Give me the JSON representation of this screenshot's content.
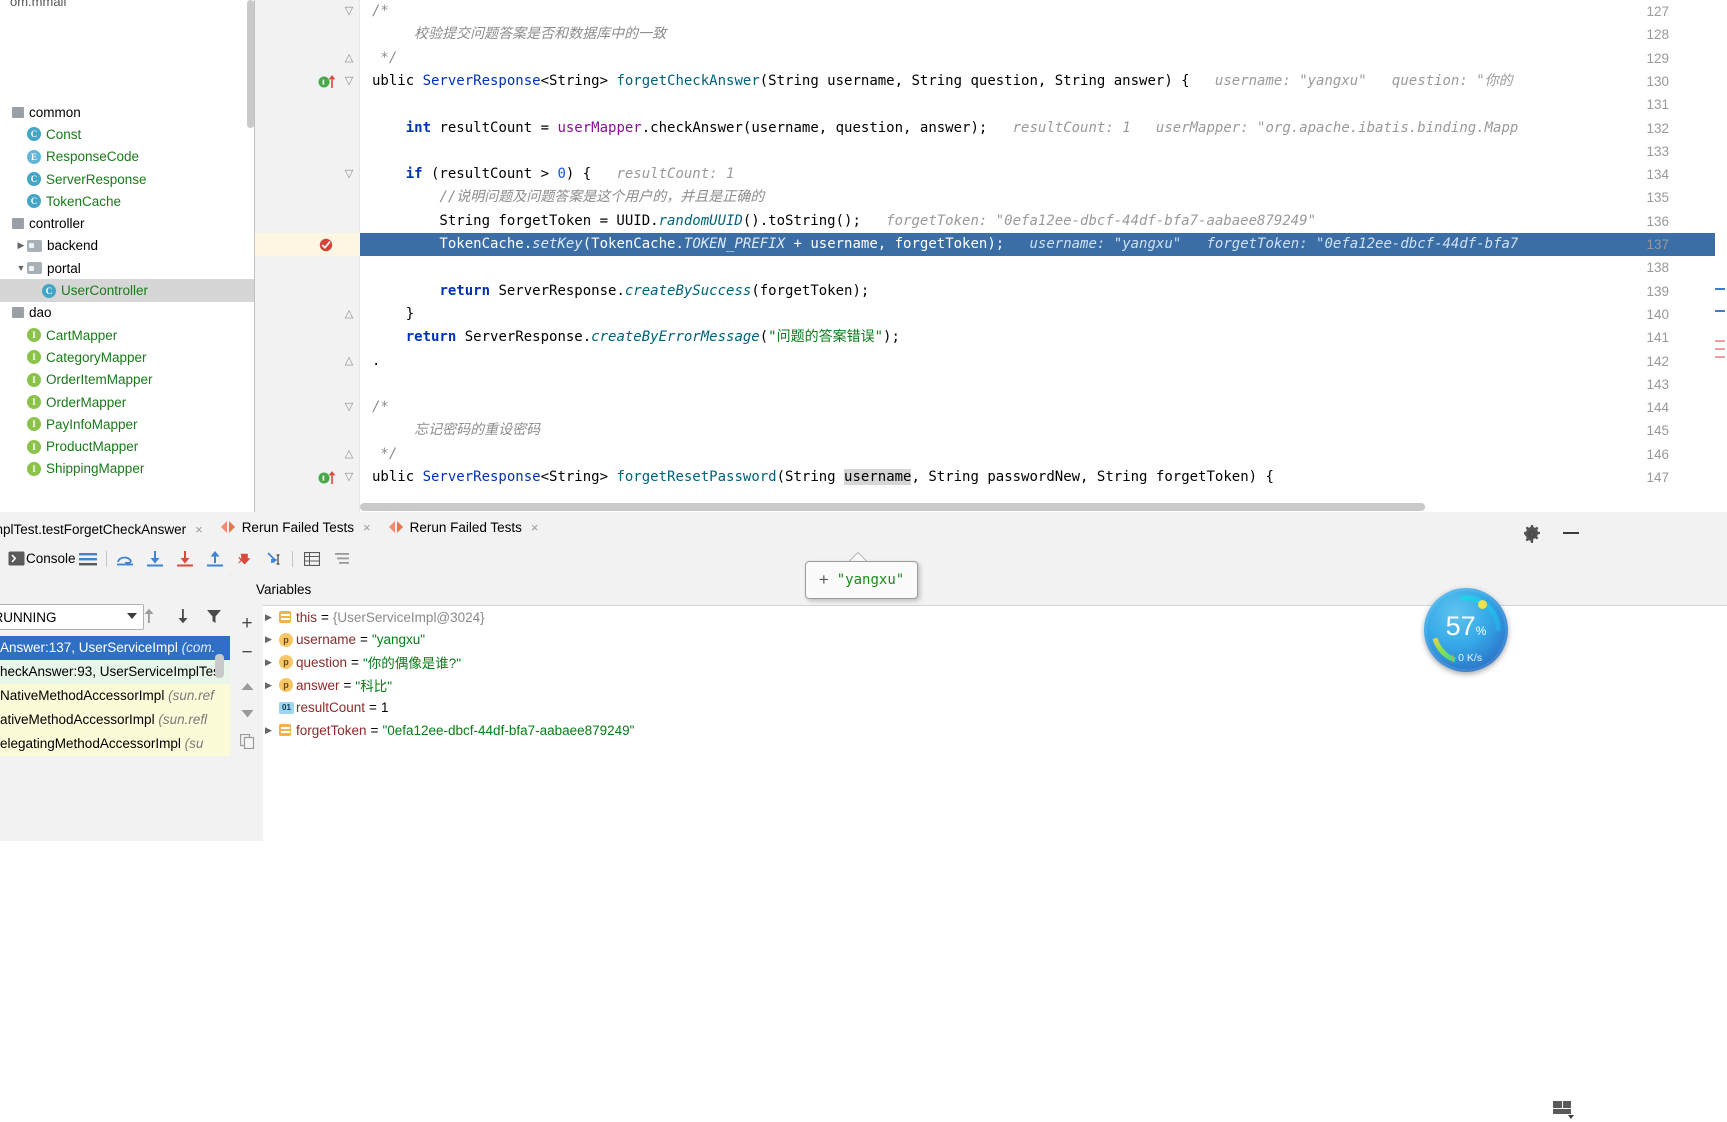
{
  "project": {
    "root": "om.mmall",
    "items": [
      {
        "indent": 0,
        "icon": "package-icon",
        "label": "common",
        "style": "plain",
        "arrow": ""
      },
      {
        "indent": 1,
        "icon": "class-icon",
        "label": "Const",
        "style": "green",
        "arrow": ""
      },
      {
        "indent": 1,
        "icon": "enum-icon",
        "label": "ResponseCode",
        "style": "green",
        "arrow": ""
      },
      {
        "indent": 1,
        "icon": "class-icon",
        "label": "ServerResponse",
        "style": "green",
        "arrow": ""
      },
      {
        "indent": 1,
        "icon": "class-icon",
        "label": "TokenCache",
        "style": "green",
        "arrow": ""
      },
      {
        "indent": 0,
        "icon": "package-icon",
        "label": "controller",
        "style": "plain",
        "arrow": ""
      },
      {
        "indent": 1,
        "icon": "folder-icon",
        "label": "backend",
        "style": "plain",
        "arrow": "▶"
      },
      {
        "indent": 1,
        "icon": "folder-icon",
        "label": "portal",
        "style": "plain",
        "arrow": "▼"
      },
      {
        "indent": 2,
        "icon": "class-icon",
        "label": "UserController",
        "style": "green",
        "arrow": "",
        "selected": true
      },
      {
        "indent": 0,
        "icon": "package-icon",
        "label": "dao",
        "style": "plain",
        "arrow": ""
      },
      {
        "indent": 1,
        "icon": "interface-icon",
        "label": "CartMapper",
        "style": "green",
        "arrow": ""
      },
      {
        "indent": 1,
        "icon": "interface-icon",
        "label": "CategoryMapper",
        "style": "green",
        "arrow": ""
      },
      {
        "indent": 1,
        "icon": "interface-icon",
        "label": "OrderItemMapper",
        "style": "green",
        "arrow": ""
      },
      {
        "indent": 1,
        "icon": "interface-icon",
        "label": "OrderMapper",
        "style": "green",
        "arrow": ""
      },
      {
        "indent": 1,
        "icon": "interface-icon",
        "label": "PayInfoMapper",
        "style": "green",
        "arrow": ""
      },
      {
        "indent": 1,
        "icon": "interface-icon",
        "label": "ProductMapper",
        "style": "green",
        "arrow": ""
      },
      {
        "indent": 1,
        "icon": "interface-icon",
        "label": "ShippingMapper",
        "style": "green",
        "arrow": ""
      }
    ]
  },
  "editor": {
    "first_line": 127,
    "highlight_line": 137,
    "lines": [
      {
        "n": 127,
        "fold": "▽",
        "html": "<span class='cmt'>/*</span>"
      },
      {
        "n": 128,
        "fold": "",
        "html": "<span class='cmt'>     校验提交问题答案是否和数据库中的一致</span>"
      },
      {
        "n": 129,
        "fold": "△",
        "html": "<span class='cmt'> */</span>"
      },
      {
        "n": 130,
        "fold": "▽",
        "gmark": "run-breakpoint",
        "html": "ublic <span class='kw2'>ServerResponse</span>&lt;String&gt; <span class='fn'>forgetCheckAnswer</span>(String username, String question, String answer) {   <span class='hint'>username: \"yangxu\"   question: \"你的</span>"
      },
      {
        "n": 131,
        "fold": "",
        "html": ""
      },
      {
        "n": 132,
        "fold": "",
        "html": "    <span class='kw'>int</span> resultCount = <span class='fld2'>userMapper</span>.checkAnswer(username, question, answer);   <span class='hint'>resultCount: 1   userMapper: \"org.apache.ibatis.binding.Mapp</span>"
      },
      {
        "n": 133,
        "fold": "",
        "html": ""
      },
      {
        "n": 134,
        "fold": "▽",
        "html": "    <span class='kw'>if</span> (resultCount &gt; <span class='num'>0</span>) {   <span class='hint'>resultCount: 1</span>"
      },
      {
        "n": 135,
        "fold": "",
        "html": "        <span class='cmt'>//说明问题及问题答案是这个用户的，并且是正确的</span>"
      },
      {
        "n": 136,
        "fold": "",
        "html": "        String forgetToken = UUID.<span class='stat'>randomUUID</span>().toString();   <span class='hint'>forgetToken: \"0efa12ee-dbcf-44df-bfa7-aabaee879249\"</span>"
      },
      {
        "n": 137,
        "fold": "",
        "gmark": "breakpoint-hit",
        "selected": true,
        "html": "        TokenCache.<span class='stat'>setKey</span>(TokenCache.<span class='stat'>TOKEN_PREFIX</span> + username, forgetToken);   <span class='hint'>username: \"yangxu\"   forgetToken: \"0efa12ee-dbcf-44df-bfa7</span>"
      },
      {
        "n": 138,
        "fold": "",
        "html": ""
      },
      {
        "n": 139,
        "fold": "",
        "html": "        <span class='kw'>return</span> ServerResponse.<span class='stat'>createBySuccess</span>(forgetToken);"
      },
      {
        "n": 140,
        "fold": "△",
        "html": "    }"
      },
      {
        "n": 141,
        "fold": "",
        "html": "    <span class='kw'>return</span> ServerResponse.<span class='stat'>createByErrorMessage</span>(<span class='str'>\"问题的答案错误\"</span>);"
      },
      {
        "n": 142,
        "fold": "△",
        "html": "."
      },
      {
        "n": 143,
        "fold": "",
        "html": ""
      },
      {
        "n": 144,
        "fold": "▽",
        "html": "<span class='cmt'>/*</span>"
      },
      {
        "n": 145,
        "fold": "",
        "html": "<span class='cmt'>     忘记密码的重设密码</span>"
      },
      {
        "n": 146,
        "fold": "△",
        "html": "<span class='cmt'> */</span>"
      },
      {
        "n": 147,
        "fold": "▽",
        "gmark": "run-breakpoint",
        "html": "ublic <span class='kw2'>ServerResponse</span>&lt;String&gt; <span class='fn'>forgetResetPassword</span>(String <span style='background:#d6d6d6'>username</span>, String passwordNew, String forgetToken) {"
      }
    ]
  },
  "run_tabs": [
    {
      "label": "ServiceImplTest.testForgetCheckAnswer",
      "icon": "",
      "close": "×",
      "active": true
    },
    {
      "label": "Rerun Failed Tests",
      "icon": "rerun-icon",
      "close": "×",
      "active": false
    },
    {
      "label": "Rerun Failed Tests",
      "icon": "rerun-icon",
      "close": "×",
      "active": false
    }
  ],
  "debug_toolbar": {
    "console_label": "Console",
    "buttons": [
      "console-toggle-icon",
      "console-label",
      "layout-lines-icon",
      "step-over-icon",
      "step-into-icon",
      "force-step-into-icon",
      "step-out-icon",
      "drop-frame-icon",
      "run-to-cursor-icon",
      "evaluate-icon",
      "show-as-table-icon",
      "mute-breakpoints-icon"
    ]
  },
  "frames": {
    "thread_selector": "i...\": RUNNING",
    "rows": [
      {
        "text": "Answer:137, UserServiceImpl ",
        "suffix": "(com.",
        "selected": true
      },
      {
        "text": "heckAnswer:93, UserServiceImplTes",
        "suffix": "",
        "tone": "n1"
      },
      {
        "text": "NativeMethodAccessorImpl ",
        "suffix": "(sun.ref",
        "tone": "n2"
      },
      {
        "text": "ativeMethodAccessorImpl ",
        "suffix": "(sun.refl",
        "tone": "n2"
      },
      {
        "text": "elegatingMethodAccessorImpl ",
        "suffix": "(su",
        "tone": "n2"
      }
    ]
  },
  "variables": {
    "header": "Variables",
    "rows": [
      {
        "tri": "▶",
        "icon": "field-icon",
        "name": "this",
        "eq": "=",
        "value": "{UserServiceImpl@3024}",
        "value_class": "obj"
      },
      {
        "tri": "▶",
        "icon": "param-icon",
        "name": "username",
        "eq": "=",
        "value": "\"yangxu\"",
        "value_class": ""
      },
      {
        "tri": "▶",
        "icon": "param-icon",
        "name": "question",
        "eq": "=",
        "value": "\"你的偶像是谁?\"",
        "value_class": ""
      },
      {
        "tri": "▶",
        "icon": "param-icon",
        "name": "answer",
        "eq": "=",
        "value": "\"科比\"",
        "value_class": ""
      },
      {
        "tri": "",
        "icon": "primitive-icon",
        "name": "resultCount",
        "eq": "=",
        "value": "1",
        "value_class": "num"
      },
      {
        "tri": "▶",
        "icon": "field-icon",
        "name": "forgetToken",
        "eq": "=",
        "value": "\"0efa12ee-dbcf-44df-bfa7-aabaee879249\"",
        "value_class": ""
      }
    ]
  },
  "tooltip": {
    "plus": "+",
    "value": "\"yangxu\""
  },
  "performance": {
    "percent": "57",
    "percent_symbol": "%",
    "network": "0 K/s",
    "up_arrow": "↑"
  },
  "colors": {
    "selection_blue": "#3a6ea5",
    "frame_selected": "#2f6fc4",
    "string_green": "#067d17",
    "keyword_blue": "#0033b3",
    "tab_underline": "#4a88c7"
  }
}
